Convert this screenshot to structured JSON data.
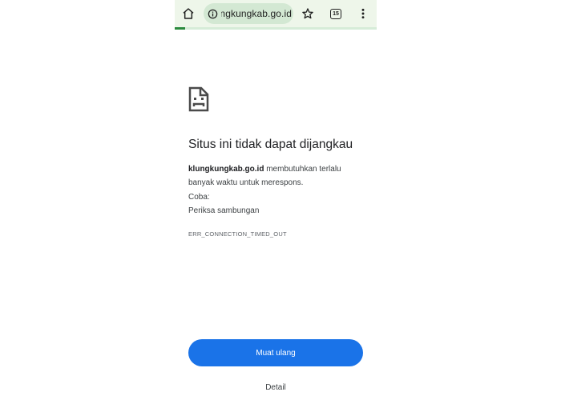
{
  "toolbar": {
    "url": "klungkungkab.go.id",
    "tab_count": "15"
  },
  "progress": {
    "fraction": 0.05
  },
  "error_page": {
    "title": "Situs ini tidak dapat dijangkau",
    "domain": "klungkungkab.go.id",
    "description_rest": " membutuhkan terlalu banyak waktu untuk merespons.",
    "try_label": "Coba:",
    "try_items": [
      "Periksa sambungan"
    ],
    "error_code": "ERR_CONNECTION_TIMED_OUT",
    "reload_label": "Muat ulang",
    "details_label": "Detail"
  },
  "colors": {
    "toolbar_bg": "#eef6ea",
    "url_pill_bg": "#d3e8d3",
    "progress": "#2b8a3e",
    "primary_button": "#1a73e8"
  },
  "icons": [
    "home-icon",
    "info-icon",
    "star-icon",
    "tab-count-icon",
    "more-vert-icon",
    "sad-page-icon"
  ]
}
